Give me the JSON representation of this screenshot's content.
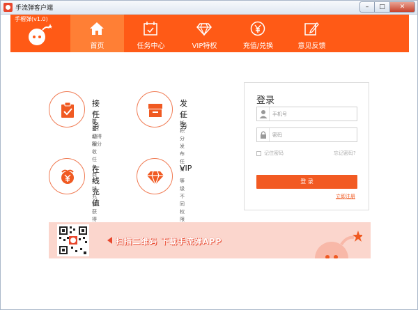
{
  "window": {
    "title": "手流弹客户端"
  },
  "header": {
    "version": "手榴弹(v1.0)",
    "nav": [
      {
        "label": "首页",
        "icon": "home-icon",
        "active": true
      },
      {
        "label": "任务中心",
        "icon": "calendar-icon",
        "active": false
      },
      {
        "label": "VIP特权",
        "icon": "diamond-icon",
        "active": false
      },
      {
        "label": "充值/兑换",
        "icon": "yen-coin-icon",
        "active": false
      },
      {
        "label": "意见反馈",
        "icon": "edit-icon",
        "active": false
      }
    ]
  },
  "features": [
    {
      "title": "接任务",
      "desc_line1": "手机自动接收任务商",
      "desc_line2": "流量，获得积分",
      "icon": "clipboard-check-icon"
    },
    {
      "title": "发任务",
      "desc_line1": "消耗积分发布任务",
      "desc_line2": "",
      "icon": "archive-box-icon"
    },
    {
      "title": "在线充值",
      "desc_line1": "在线充值获得积分",
      "desc_line2": "",
      "icon": "yen-coin-icon"
    },
    {
      "title": "VIP",
      "desc_line1": "等级不同权限不同",
      "desc_line2": "",
      "icon": "diamond-icon"
    }
  ],
  "login": {
    "heading": "登录",
    "phone_placeholder": "手机号",
    "password_placeholder": "密码",
    "remember_label": "记住密码",
    "forgot_label": "忘记密码?",
    "submit_label": "登 录",
    "register_label": "立即注册"
  },
  "banner": {
    "text": "扫描二维码  下载手流弹APP"
  },
  "colors": {
    "brand": "#ff5a16",
    "nav_active": "#ff7f35",
    "login_button": "#f25a22",
    "banner_bg": "#fbd6cd"
  }
}
